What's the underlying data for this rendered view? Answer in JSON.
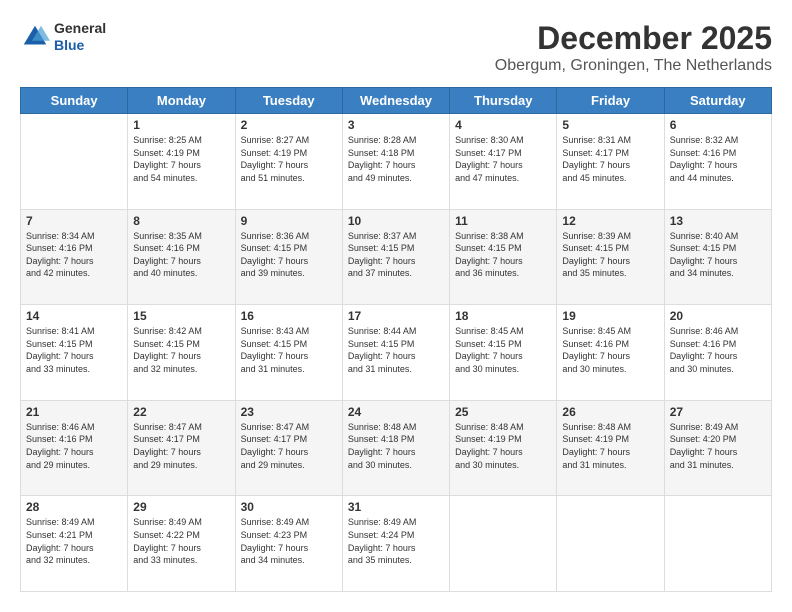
{
  "logo": {
    "general": "General",
    "blue": "Blue"
  },
  "header": {
    "title": "December 2025",
    "subtitle": "Obergum, Groningen, The Netherlands"
  },
  "days_of_week": [
    "Sunday",
    "Monday",
    "Tuesday",
    "Wednesday",
    "Thursday",
    "Friday",
    "Saturday"
  ],
  "weeks": [
    [
      {
        "day": "",
        "info": ""
      },
      {
        "day": "1",
        "info": "Sunrise: 8:25 AM\nSunset: 4:19 PM\nDaylight: 7 hours\nand 54 minutes."
      },
      {
        "day": "2",
        "info": "Sunrise: 8:27 AM\nSunset: 4:19 PM\nDaylight: 7 hours\nand 51 minutes."
      },
      {
        "day": "3",
        "info": "Sunrise: 8:28 AM\nSunset: 4:18 PM\nDaylight: 7 hours\nand 49 minutes."
      },
      {
        "day": "4",
        "info": "Sunrise: 8:30 AM\nSunset: 4:17 PM\nDaylight: 7 hours\nand 47 minutes."
      },
      {
        "day": "5",
        "info": "Sunrise: 8:31 AM\nSunset: 4:17 PM\nDaylight: 7 hours\nand 45 minutes."
      },
      {
        "day": "6",
        "info": "Sunrise: 8:32 AM\nSunset: 4:16 PM\nDaylight: 7 hours\nand 44 minutes."
      }
    ],
    [
      {
        "day": "7",
        "info": "Sunrise: 8:34 AM\nSunset: 4:16 PM\nDaylight: 7 hours\nand 42 minutes."
      },
      {
        "day": "8",
        "info": "Sunrise: 8:35 AM\nSunset: 4:16 PM\nDaylight: 7 hours\nand 40 minutes."
      },
      {
        "day": "9",
        "info": "Sunrise: 8:36 AM\nSunset: 4:15 PM\nDaylight: 7 hours\nand 39 minutes."
      },
      {
        "day": "10",
        "info": "Sunrise: 8:37 AM\nSunset: 4:15 PM\nDaylight: 7 hours\nand 37 minutes."
      },
      {
        "day": "11",
        "info": "Sunrise: 8:38 AM\nSunset: 4:15 PM\nDaylight: 7 hours\nand 36 minutes."
      },
      {
        "day": "12",
        "info": "Sunrise: 8:39 AM\nSunset: 4:15 PM\nDaylight: 7 hours\nand 35 minutes."
      },
      {
        "day": "13",
        "info": "Sunrise: 8:40 AM\nSunset: 4:15 PM\nDaylight: 7 hours\nand 34 minutes."
      }
    ],
    [
      {
        "day": "14",
        "info": "Sunrise: 8:41 AM\nSunset: 4:15 PM\nDaylight: 7 hours\nand 33 minutes."
      },
      {
        "day": "15",
        "info": "Sunrise: 8:42 AM\nSunset: 4:15 PM\nDaylight: 7 hours\nand 32 minutes."
      },
      {
        "day": "16",
        "info": "Sunrise: 8:43 AM\nSunset: 4:15 PM\nDaylight: 7 hours\nand 31 minutes."
      },
      {
        "day": "17",
        "info": "Sunrise: 8:44 AM\nSunset: 4:15 PM\nDaylight: 7 hours\nand 31 minutes."
      },
      {
        "day": "18",
        "info": "Sunrise: 8:45 AM\nSunset: 4:15 PM\nDaylight: 7 hours\nand 30 minutes."
      },
      {
        "day": "19",
        "info": "Sunrise: 8:45 AM\nSunset: 4:16 PM\nDaylight: 7 hours\nand 30 minutes."
      },
      {
        "day": "20",
        "info": "Sunrise: 8:46 AM\nSunset: 4:16 PM\nDaylight: 7 hours\nand 30 minutes."
      }
    ],
    [
      {
        "day": "21",
        "info": "Sunrise: 8:46 AM\nSunset: 4:16 PM\nDaylight: 7 hours\nand 29 minutes."
      },
      {
        "day": "22",
        "info": "Sunrise: 8:47 AM\nSunset: 4:17 PM\nDaylight: 7 hours\nand 29 minutes."
      },
      {
        "day": "23",
        "info": "Sunrise: 8:47 AM\nSunset: 4:17 PM\nDaylight: 7 hours\nand 29 minutes."
      },
      {
        "day": "24",
        "info": "Sunrise: 8:48 AM\nSunset: 4:18 PM\nDaylight: 7 hours\nand 30 minutes."
      },
      {
        "day": "25",
        "info": "Sunrise: 8:48 AM\nSunset: 4:19 PM\nDaylight: 7 hours\nand 30 minutes."
      },
      {
        "day": "26",
        "info": "Sunrise: 8:48 AM\nSunset: 4:19 PM\nDaylight: 7 hours\nand 31 minutes."
      },
      {
        "day": "27",
        "info": "Sunrise: 8:49 AM\nSunset: 4:20 PM\nDaylight: 7 hours\nand 31 minutes."
      }
    ],
    [
      {
        "day": "28",
        "info": "Sunrise: 8:49 AM\nSunset: 4:21 PM\nDaylight: 7 hours\nand 32 minutes."
      },
      {
        "day": "29",
        "info": "Sunrise: 8:49 AM\nSunset: 4:22 PM\nDaylight: 7 hours\nand 33 minutes."
      },
      {
        "day": "30",
        "info": "Sunrise: 8:49 AM\nSunset: 4:23 PM\nDaylight: 7 hours\nand 34 minutes."
      },
      {
        "day": "31",
        "info": "Sunrise: 8:49 AM\nSunset: 4:24 PM\nDaylight: 7 hours\nand 35 minutes."
      },
      {
        "day": "",
        "info": ""
      },
      {
        "day": "",
        "info": ""
      },
      {
        "day": "",
        "info": ""
      }
    ]
  ]
}
